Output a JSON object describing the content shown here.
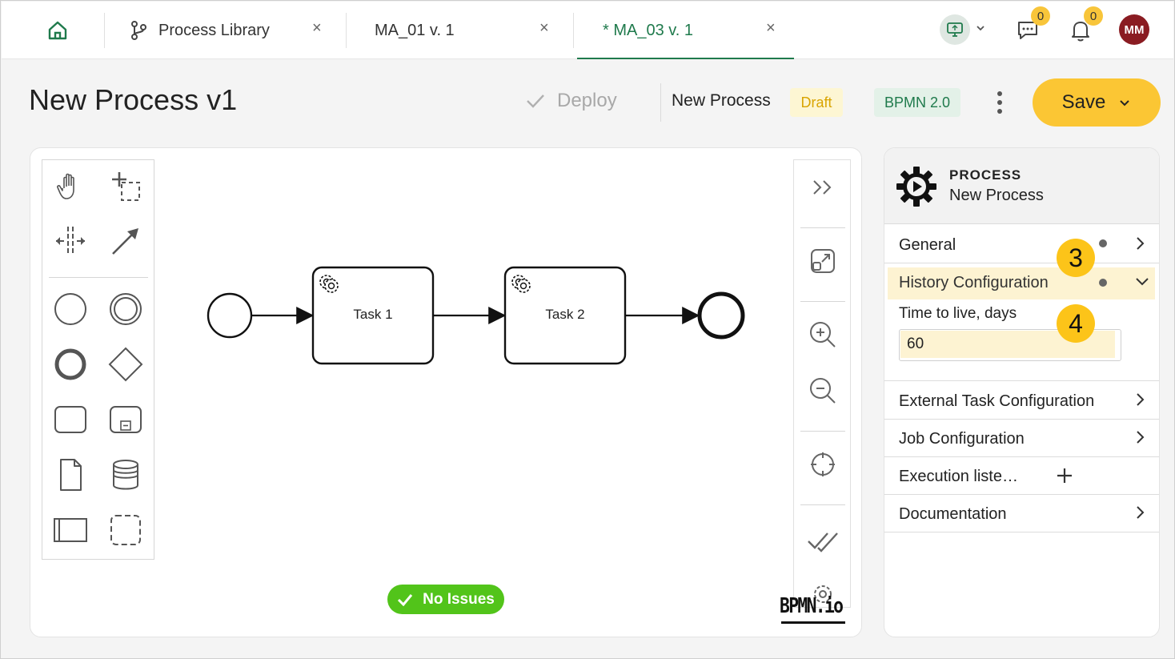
{
  "tabs": [
    {
      "label": "Process Library"
    },
    {
      "label": "MA_01 v. 1"
    },
    {
      "label": "* MA_03 v. 1"
    }
  ],
  "topbar": {
    "chat_count": "0",
    "notif_count": "0",
    "avatar_initials": "MM"
  },
  "header": {
    "title": "New Process v1",
    "deploy_label": "Deploy",
    "process_name": "New Process",
    "status": "Draft",
    "bpmn_version": "BPMN 2.0",
    "save_label": "Save"
  },
  "diagram": {
    "tasks": [
      "Task 1",
      "Task 2"
    ]
  },
  "status_pill": "No Issues",
  "watermark": "BPMN.io",
  "properties": {
    "type": "PROCESS",
    "name": "New Process",
    "sections": {
      "general": "General",
      "history": "History Configuration",
      "time_to_live_label": "Time to live, days",
      "time_to_live_value": "60",
      "external_task": "External Task Configuration",
      "job": "Job Configuration",
      "execution_listeners": "Execution liste…",
      "documentation": "Documentation"
    }
  },
  "callouts": [
    "3",
    "4"
  ],
  "colors": {
    "accent_green": "#1f7a4c",
    "save_yellow": "#fbc634",
    "callout_yellow": "#fcc419",
    "status_green": "#52c41a",
    "avatar_red": "#8a1c22"
  }
}
